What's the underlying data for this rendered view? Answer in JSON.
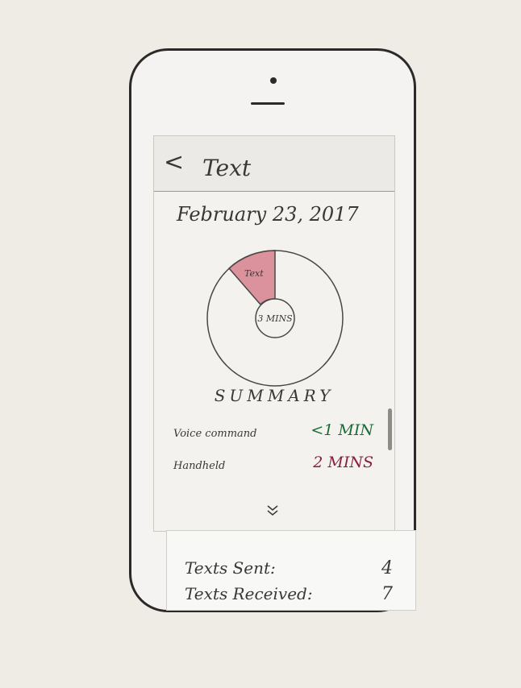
{
  "header": {
    "back_icon": "<",
    "title": "Text"
  },
  "date": "February 23, 2017",
  "chart": {
    "segment_label": "Text",
    "center_label": "3 MINS",
    "segment_color": "#c8435a"
  },
  "summary": {
    "title": "SUMMARY",
    "rows": [
      {
        "label": "Voice command",
        "value": "<1 MIN",
        "color": "#1a6b35"
      },
      {
        "label": "Handheld",
        "value": "2 MINS",
        "color": "#8a1f3d"
      }
    ]
  },
  "stats": {
    "texts_sent_label": "Texts Sent:",
    "texts_sent_value": "4",
    "texts_received_label": "Texts Received:",
    "texts_received_value": "7"
  },
  "icons": {
    "back": "back-icon",
    "expand": "double-chevron-down-icon"
  }
}
